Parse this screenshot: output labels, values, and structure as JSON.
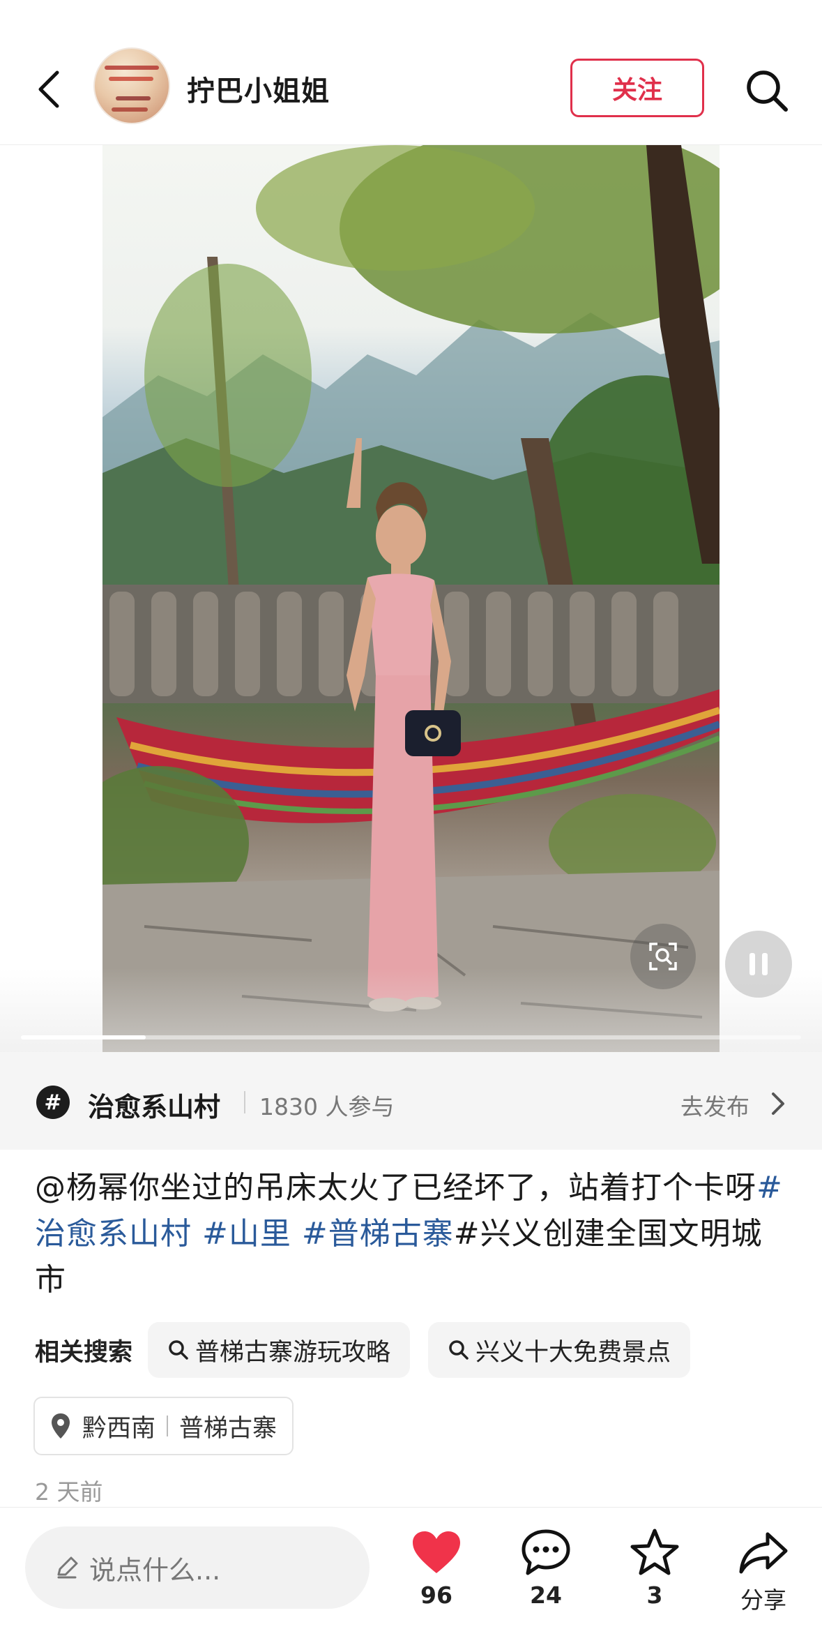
{
  "header": {
    "username": "拧巴小姐姐",
    "follow_label": "关注"
  },
  "media": {
    "progress_fraction": 0.16
  },
  "topic": {
    "name": "治愈系山村",
    "participants": "1830 人参与",
    "publish_label": "去发布"
  },
  "caption": {
    "text_1": "@杨幂你坐过的吊床太火了已经坏了，站着打个卡呀",
    "tag_1": "#治愈系山村",
    "tag_2": " #山里",
    "tag_3": " #普梯古寨",
    "tag_4": "#兴义创建全国文明城市"
  },
  "related": {
    "label": "相关搜索",
    "items": [
      "普梯古寨游玩攻略",
      "兴义十大免费景点"
    ]
  },
  "location": {
    "region": "黔西南",
    "place": "普梯古寨"
  },
  "time": "2 天前",
  "bottom": {
    "comment_placeholder": "说点什么...",
    "likes": "96",
    "comments": "24",
    "favorites": "3",
    "share_label": "分享"
  },
  "colors": {
    "accent": "#e0304b",
    "hashtag": "#2a5a9a",
    "like": "#f0334a"
  }
}
